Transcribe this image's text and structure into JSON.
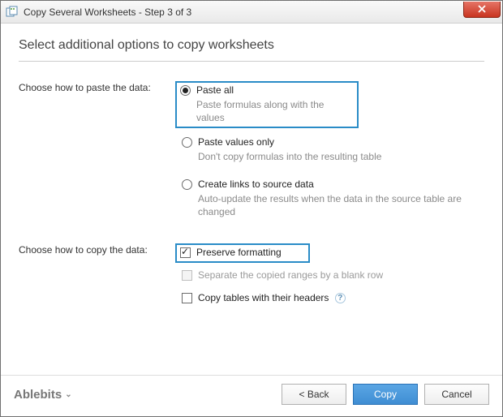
{
  "window": {
    "title": "Copy Several Worksheets - Step 3 of 3"
  },
  "heading": "Select additional options to copy worksheets",
  "sections": {
    "paste": {
      "label": "Choose how to paste the data:",
      "options": {
        "all": {
          "label": "Paste all",
          "desc": "Paste formulas along with the values"
        },
        "values": {
          "label": "Paste values only",
          "desc": "Don't copy formulas into the resulting table"
        },
        "links": {
          "label": "Create links to source data",
          "desc": "Auto-update the results when the data in the source table are changed"
        }
      }
    },
    "copy": {
      "label": "Choose how to copy the data:",
      "options": {
        "preserve": {
          "label": "Preserve formatting"
        },
        "separate": {
          "label": "Separate the copied ranges by a blank row"
        },
        "headers": {
          "label": "Copy tables with their headers"
        }
      }
    }
  },
  "footer": {
    "brand": "Ablebits",
    "back": "<  Back",
    "copy": "Copy",
    "cancel": "Cancel"
  }
}
